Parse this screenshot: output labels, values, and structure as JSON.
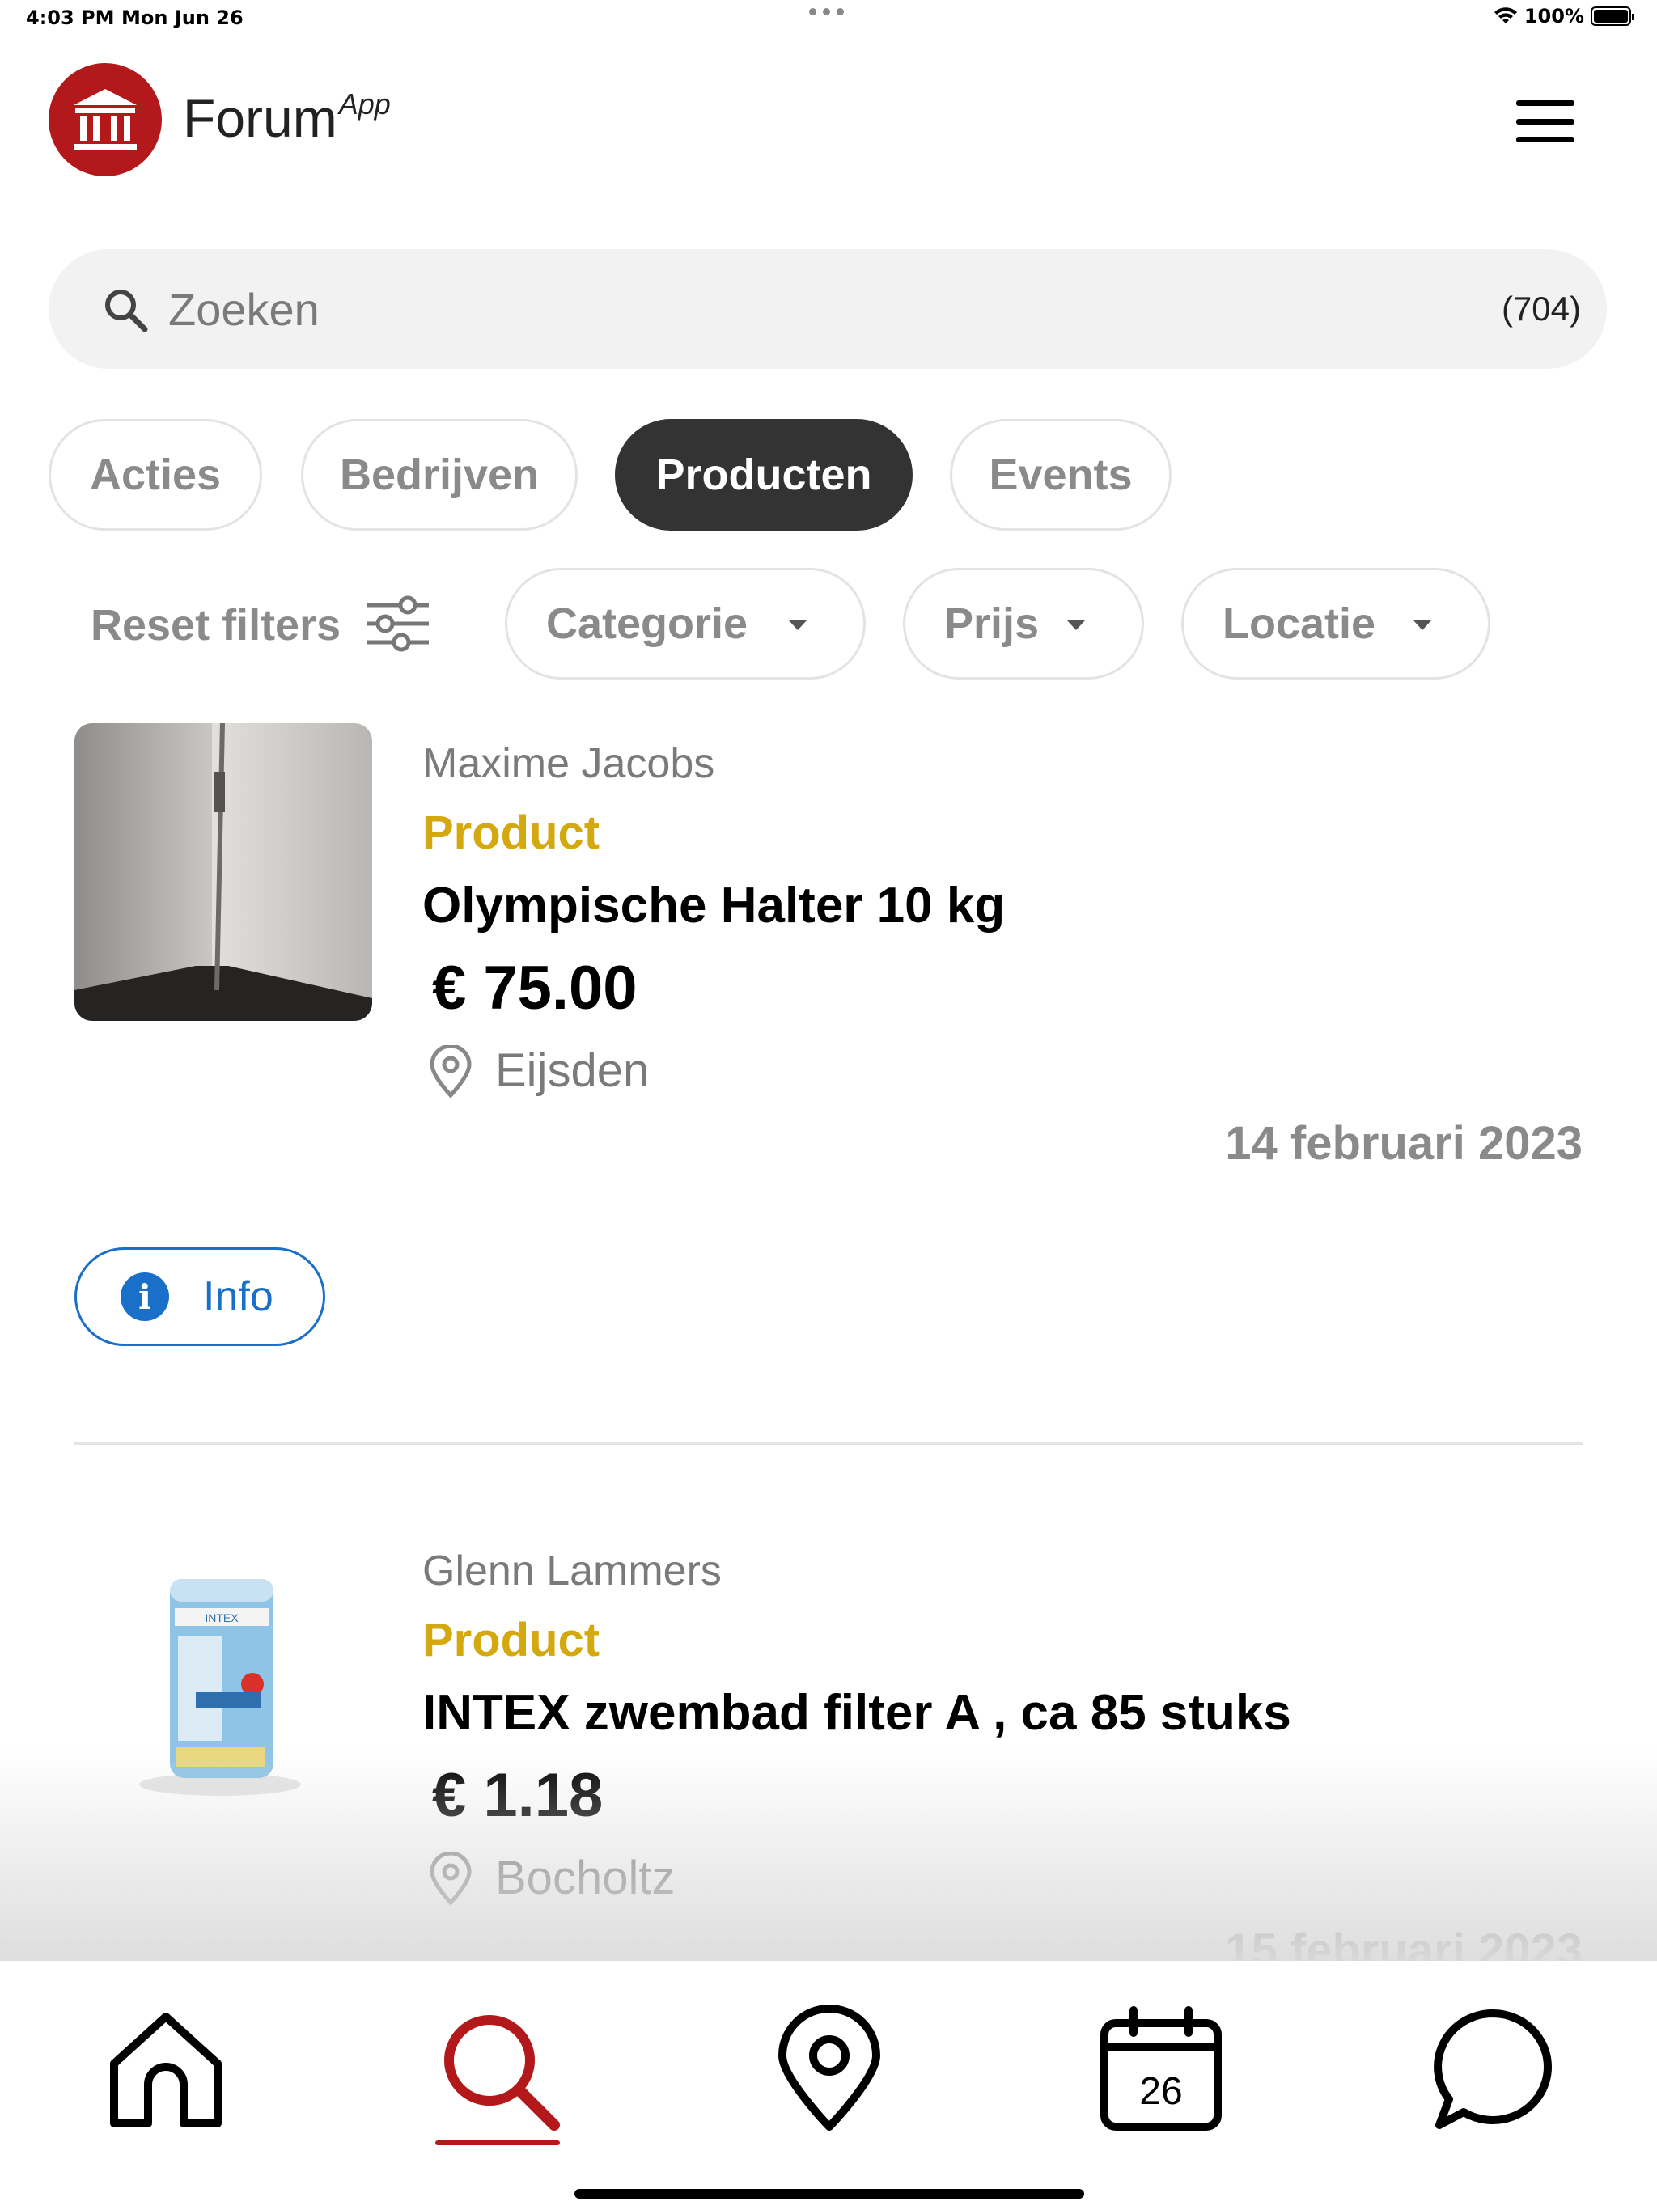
{
  "status_bar": {
    "time": "4:03 PM",
    "date": "Mon Jun 26",
    "battery": "100%"
  },
  "header": {
    "brand": "Forum",
    "brand_super": "App"
  },
  "search": {
    "placeholder": "Zoeken",
    "count": "(704)"
  },
  "tabs": [
    {
      "label": "Acties",
      "active": false
    },
    {
      "label": "Bedrijven",
      "active": false
    },
    {
      "label": "Producten",
      "active": true
    },
    {
      "label": "Events",
      "active": false
    }
  ],
  "filters": {
    "reset_label": "Reset filters",
    "categorie": "Categorie",
    "prijs": "Prijs",
    "locatie": "Locatie"
  },
  "listings": [
    {
      "seller": "Maxime Jacobs",
      "kind": "Product",
      "title": "Olympische Halter 10 kg",
      "price": "€ 75.00",
      "location": "Eijsden",
      "date": "14 februari 2023",
      "info_label": "Info"
    },
    {
      "seller": "Glenn Lammers",
      "kind": "Product",
      "title": "INTEX zwembad filter A , ca 85 stuks",
      "price": "€ 1.18",
      "location": "Bocholtz",
      "date": "15 februari 2023",
      "thumb_text": "INTEX"
    }
  ],
  "tabbar": {
    "calendar_day": "26",
    "active": "search"
  },
  "colors": {
    "brand_red": "#b3191b",
    "product_gold": "#d4a80f",
    "info_blue": "#1a6fc9",
    "active_tab": "#333333"
  }
}
